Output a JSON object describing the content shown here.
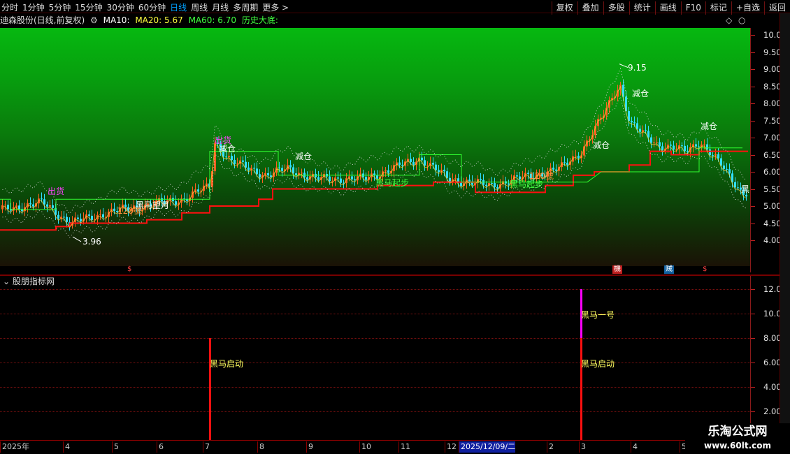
{
  "toolbar": {
    "periods": [
      "分时",
      "1分钟",
      "5分钟",
      "15分钟",
      "30分钟",
      "60分钟",
      "日线",
      "周线",
      "月线",
      "多周期",
      "更多 >"
    ],
    "active_period": "日线",
    "tools": [
      "复权",
      "叠加",
      "多股",
      "统计",
      "画线",
      "F10",
      "标记",
      "+自选",
      "返回"
    ]
  },
  "stock": {
    "title": "迪森股份(日线,前复权)",
    "ma10_label": "MA10:",
    "ma20_label": "MA20: 5.67",
    "ma60_label": "MA60: 6.70",
    "extra_label": "历史大底:"
  },
  "colors": {
    "up": "#ff6020",
    "down": "#30e0ff",
    "red_line": "#ff1010",
    "green_box": "#30ff30",
    "ma_yellow": "#ffff00",
    "magenta": "#ff00ff"
  },
  "price_axis": {
    "labels": [
      "10.00",
      "9.50",
      "9.00",
      "8.50",
      "8.00",
      "7.50",
      "7.00",
      "6.50",
      "6.00",
      "5.50",
      "5.00",
      "4.50",
      "4.00"
    ]
  },
  "annotations": {
    "high": "9.15",
    "low": "3.96",
    "jian_cang": "减仓",
    "chu_huo": "出货",
    "hei_ma_qi_bu": "黑马起步",
    "hei_ma_wang_yue": "黑马望月",
    "hao_120": "120號",
    "hei": "黑"
  },
  "mark_strip": [
    "$",
    "$",
    "$",
    "機",
    "贼"
  ],
  "sub_panel": {
    "title": "股朋指标网",
    "axis_labels": [
      "12.00",
      "10.00",
      "8.00",
      "6.00",
      "4.00",
      "2.00"
    ],
    "bars": [
      {
        "label": "黑马启动",
        "value": 8,
        "color": "#ff1010"
      },
      {
        "label": "黑马启动",
        "value": 8,
        "color": "#ff1010"
      },
      {
        "label": "黑马一号",
        "value": 12,
        "color": "#ff00ff"
      }
    ]
  },
  "x_axis": {
    "labels": [
      "2025年",
      "4",
      "5",
      "6",
      "7",
      "8",
      "9",
      "10",
      "11",
      "12",
      "2025/12/09/二",
      "2",
      "3",
      "4",
      "5"
    ],
    "selected": "2025/12/09/二"
  },
  "watermark": {
    "line1": "乐淘公式网",
    "line2": "www.60lt.com"
  }
}
